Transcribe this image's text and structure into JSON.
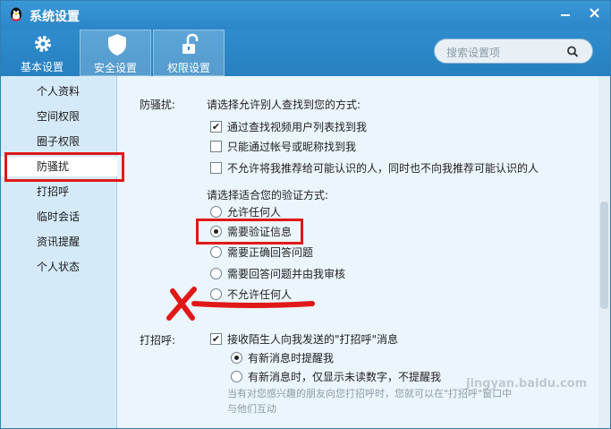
{
  "window": {
    "title": "系统设置"
  },
  "toolbar": {
    "buttons": [
      {
        "label": "基本设置",
        "icon": "gear-icon"
      },
      {
        "label": "安全设置",
        "icon": "shield-icon"
      },
      {
        "label": "权限设置",
        "icon": "unlock-icon"
      }
    ],
    "search_placeholder": "搜索设置项"
  },
  "sidebar": {
    "items": [
      {
        "label": "个人资料"
      },
      {
        "label": "空间权限"
      },
      {
        "label": "圈子权限"
      },
      {
        "label": "防骚扰",
        "selected": true
      },
      {
        "label": "打招呼"
      },
      {
        "label": "临时会话"
      },
      {
        "label": "资讯提醒"
      },
      {
        "label": "个人状态"
      }
    ]
  },
  "harassment": {
    "section_label": "防骚扰:",
    "find_prompt": "请选择允许别人查找到您的方式:",
    "find_options": [
      {
        "label": "通过查找视频用户列表找到我",
        "checked": true
      },
      {
        "label": "只能通过帐号或昵称找到我",
        "checked": false
      },
      {
        "label": "不允许将我推荐给可能认识的人，同时也不向我推荐可能认识的人",
        "checked": false
      }
    ],
    "verify_prompt": "请选择适合您的验证方式:",
    "verify_options": [
      {
        "label": "允许任何人",
        "selected": false
      },
      {
        "label": "需要验证信息",
        "selected": true
      },
      {
        "label": "需要正确回答问题",
        "selected": false
      },
      {
        "label": "需要回答问题并由我审核",
        "selected": false
      },
      {
        "label": "不允许任何人",
        "selected": false
      }
    ]
  },
  "greeting": {
    "section_label": "打招呼:",
    "accept_label": "接收陌生人向我发送的\"打招呼\"消息",
    "accept_checked": true,
    "notify_options": [
      {
        "label": "有新消息时提醒我",
        "selected": true
      },
      {
        "label": "有新消息时，仅显示未读数字，不提醒我",
        "selected": false
      }
    ],
    "hint_line1": "当有对您感兴趣的朋友向您打招呼时，您就可以在\"打招呼\"窗口中",
    "hint_line2": "与他们互动"
  },
  "watermark": "jingyan.baidu.com",
  "colors": {
    "titlebar": "#2b86c8",
    "highlight": "#e01818",
    "sidebar": "#d5eaf8"
  }
}
